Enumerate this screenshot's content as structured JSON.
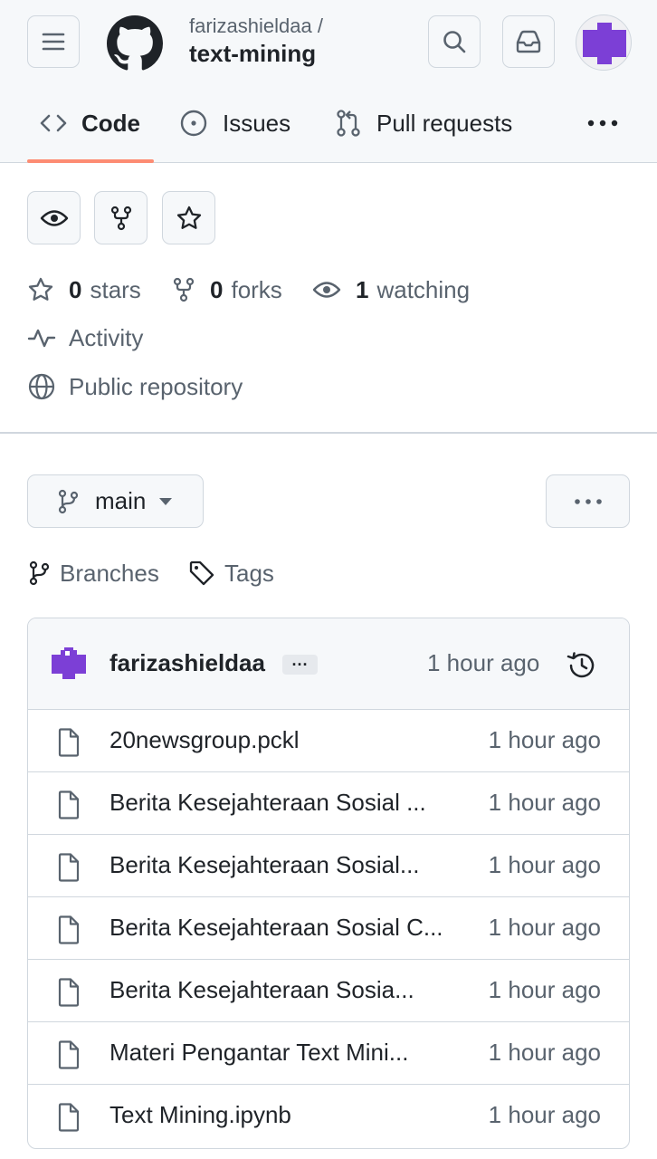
{
  "header": {
    "owner": "farizashieldaa /",
    "repo": "text-mining",
    "icons": [
      "hamburger-icon",
      "github-logo",
      "search-icon",
      "inbox-icon",
      "avatar"
    ]
  },
  "tabs": [
    {
      "label": "Code",
      "icon": "code-icon",
      "selected": true
    },
    {
      "label": "Issues",
      "icon": "issue-icon"
    },
    {
      "label": "Pull requests",
      "icon": "pull-request-icon"
    }
  ],
  "actions": [
    "eye-icon",
    "fork-icon",
    "star-icon"
  ],
  "stats": {
    "stars_count": "0",
    "stars_label": "stars",
    "forks_count": "0",
    "forks_label": "forks",
    "watching_count": "1",
    "watching_label": "watching",
    "activity": "Activity",
    "visibility": "Public repository"
  },
  "branch": {
    "name": "main",
    "branches_label": "Branches",
    "tags_label": "Tags"
  },
  "commit": {
    "author": "farizashieldaa",
    "dots": "···",
    "time": "1 hour ago"
  },
  "files": [
    {
      "name": "20newsgroup.pckl",
      "time": "1 hour ago"
    },
    {
      "name": "Berita Kesejahteraan Sosial ...",
      "time": "1 hour ago"
    },
    {
      "name": "Berita Kesejahteraan Sosial...",
      "time": "1 hour ago"
    },
    {
      "name": "Berita Kesejahteraan Sosial C...",
      "time": "1 hour ago"
    },
    {
      "name": "Berita Kesejahteraan Sosia...",
      "time": "1 hour ago"
    },
    {
      "name": "Materi Pengantar Text Mini...",
      "time": "1 hour ago"
    },
    {
      "name": "Text Mining.ipynb",
      "time": "1 hour ago"
    }
  ],
  "colors": {
    "accent_underline": "#fd8c73",
    "avatar_purple": "#7c3fd6",
    "border": "#d0d7de",
    "muted_text": "#59636e"
  }
}
